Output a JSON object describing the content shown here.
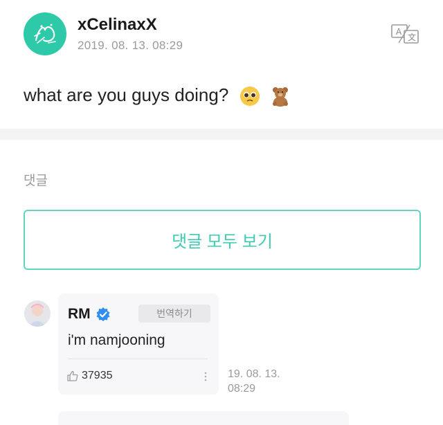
{
  "post": {
    "author": "xCelinaxX",
    "timestamp": "2019. 08. 13. 08:29",
    "text": "what are you guys doing?",
    "emojis": [
      "pleading-face-emoji",
      "teddy-bear-emoji"
    ],
    "translate_icon": "translate-icon"
  },
  "comments_section": {
    "label": "댓글",
    "view_all_label": "댓글 모두 보기"
  },
  "comments": [
    {
      "author": "RM",
      "verified_icon": "verified-badge-icon",
      "translate_label": "번역하기",
      "text": "i'm namjooning",
      "likes": "37935",
      "timestamp_line1": "19. 08. 13.",
      "timestamp_line2": "08:29"
    }
  ],
  "colors": {
    "accent": "#3dcbb1",
    "avatar_bg": "#2ec9a8",
    "verified": "#2f8ef0",
    "muted": "#9a9a9a"
  }
}
